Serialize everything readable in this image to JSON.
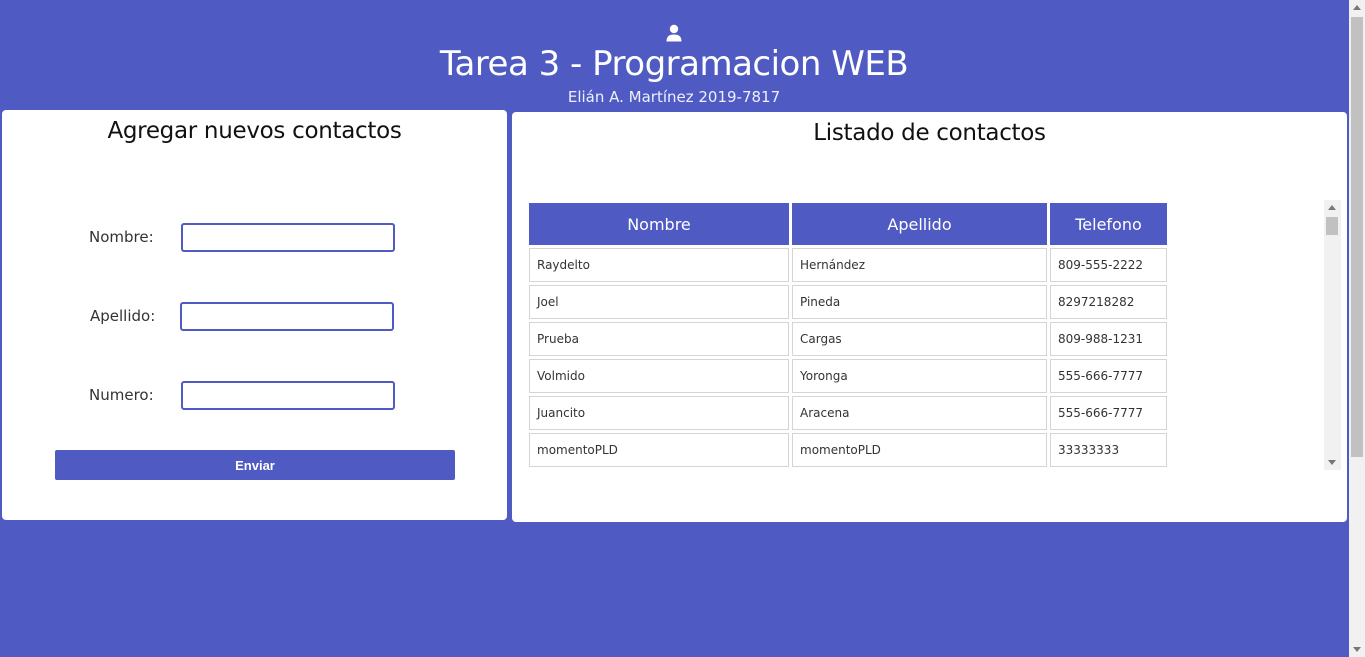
{
  "header": {
    "title": "Tarea 3 - Programacion WEB",
    "subtitle": "Elián A. Martínez 2019-7817",
    "icon": "user-icon"
  },
  "form": {
    "heading": "Agregar nuevos contactos",
    "fields": [
      {
        "label": "Nombre:",
        "value": ""
      },
      {
        "label": "Apellido:",
        "value": ""
      },
      {
        "label": "Numero:",
        "value": ""
      }
    ],
    "submit_label": "Enviar"
  },
  "list": {
    "heading": "Listado de contactos",
    "columns": [
      "Nombre",
      "Apellido",
      "Telefono"
    ],
    "rows": [
      [
        "Raydelto",
        "Hernández",
        "809-555-2222"
      ],
      [
        "Joel",
        "Pineda",
        "8297218282"
      ],
      [
        "Prueba",
        "Cargas",
        "809-988-1231"
      ],
      [
        "Volmido",
        "Yoronga",
        "555-666-7777"
      ],
      [
        "Juancito",
        "Aracena",
        "555-666-7777"
      ],
      [
        "momentoPLD",
        "momentoPLD",
        "33333333"
      ]
    ]
  },
  "colors": {
    "accent": "#4f5bc2",
    "panel": "#ffffff"
  }
}
